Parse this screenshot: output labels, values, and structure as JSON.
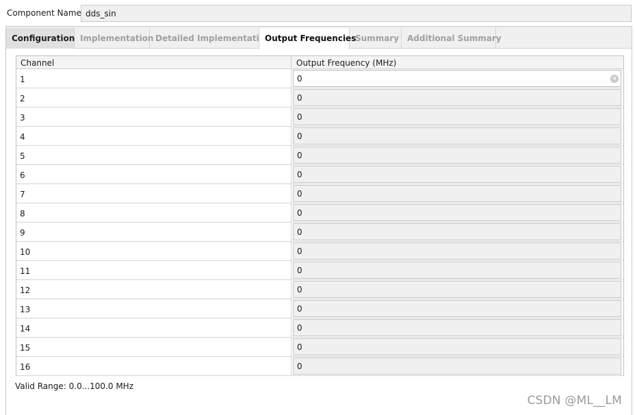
{
  "component": {
    "label": "Component Name",
    "value": "dds_sin"
  },
  "tabs": [
    {
      "label": "Configuration",
      "state": "enabled"
    },
    {
      "label": "Implementation",
      "state": "disabled"
    },
    {
      "label": "Detailed Implementation",
      "state": "disabled"
    },
    {
      "label": "Output Frequencies",
      "state": "active"
    },
    {
      "label": "Summary",
      "state": "disabled"
    },
    {
      "label": "Additional Summary",
      "state": "disabled"
    }
  ],
  "table": {
    "headers": {
      "channel": "Channel",
      "freq": "Output Frequency (MHz)"
    },
    "rows": [
      {
        "channel": "1",
        "value": "0"
      },
      {
        "channel": "2",
        "value": "0"
      },
      {
        "channel": "3",
        "value": "0"
      },
      {
        "channel": "4",
        "value": "0"
      },
      {
        "channel": "5",
        "value": "0"
      },
      {
        "channel": "6",
        "value": "0"
      },
      {
        "channel": "7",
        "value": "0"
      },
      {
        "channel": "8",
        "value": "0"
      },
      {
        "channel": "9",
        "value": "0"
      },
      {
        "channel": "10",
        "value": "0"
      },
      {
        "channel": "11",
        "value": "0"
      },
      {
        "channel": "12",
        "value": "0"
      },
      {
        "channel": "13",
        "value": "0"
      },
      {
        "channel": "14",
        "value": "0"
      },
      {
        "channel": "15",
        "value": "0"
      },
      {
        "channel": "16",
        "value": "0"
      }
    ]
  },
  "valid_range": "Valid Range: 0.0...100.0 MHz",
  "watermark": "CSDN @ML__LM",
  "icons": {
    "clear": "clear-circle-icon"
  },
  "colors": {
    "disabled_tab_text": "#a0a0a0",
    "active_tab_bg": "#ffffff",
    "field_bg": "#f0f0f0"
  }
}
